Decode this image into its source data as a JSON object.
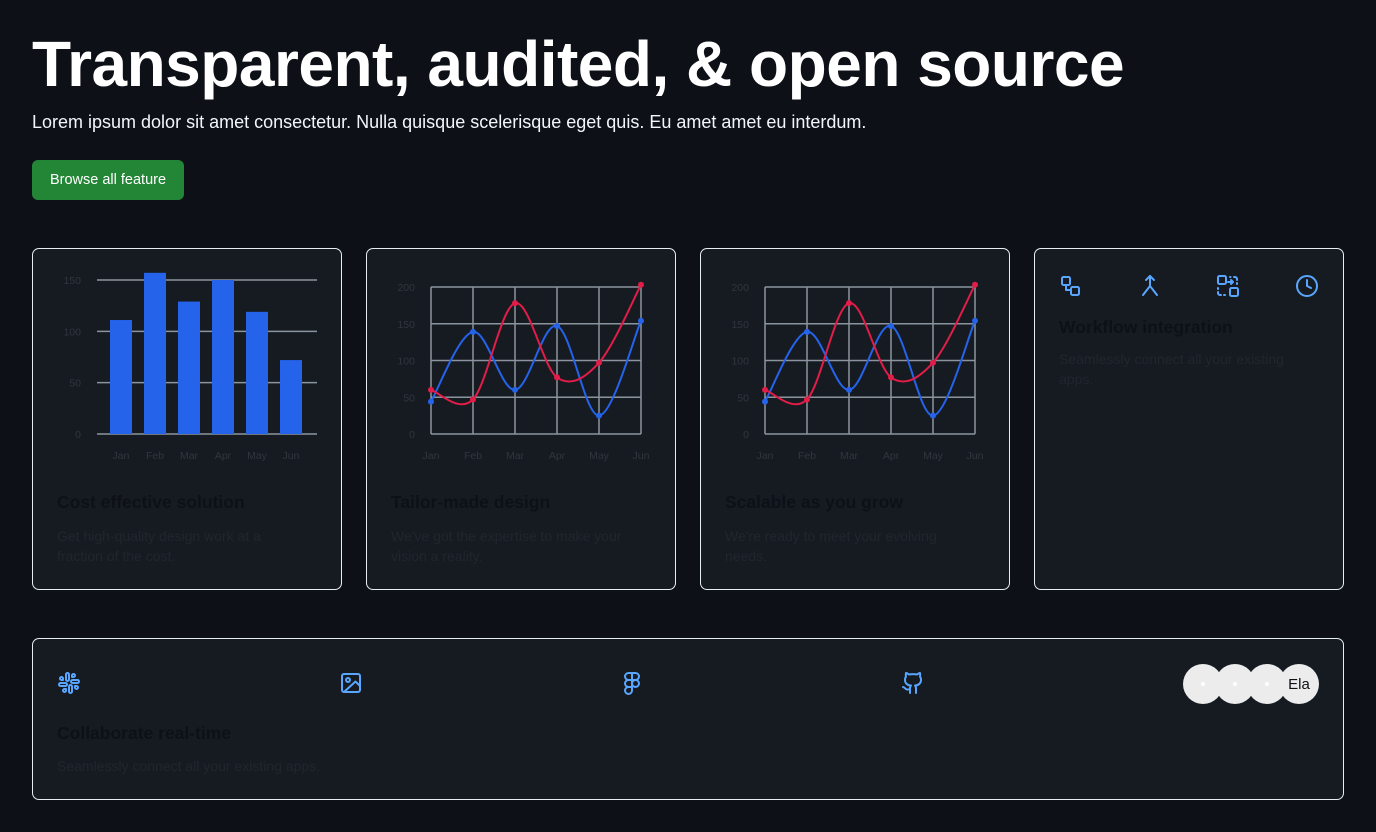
{
  "hero": {
    "title": "Transparent, audited, & open source",
    "subtitle": "Lorem ipsum dolor sit amet consectetur. Nulla quisque scelerisque eget quis. Eu amet amet eu interdum.",
    "cta_label": "Browse all feature"
  },
  "cards": [
    {
      "title": "Cost effective solution",
      "description": "Get high-quality design work at a fraction of the cost."
    },
    {
      "title": "Tailor-made design",
      "description": "We've got the expertise to make your vision a reality."
    },
    {
      "title": "Scalable as you grow",
      "description": "We're ready to meet your evolving needs."
    },
    {
      "title": "Workflow integration",
      "description": "Seamlessly connect all your existing apps."
    }
  ],
  "workflow_icons": [
    "workflow-icon",
    "merge-icon",
    "integration-icon",
    "clock-icon"
  ],
  "collaborate": {
    "title": "Collaborate real-time",
    "description": "Seamlessly connect all your existing apps.",
    "icons": [
      "slack-icon",
      "image-icon",
      "figma-icon",
      "github-icon"
    ],
    "avatars": [
      "",
      "",
      "",
      "Ela"
    ]
  },
  "colors": {
    "background": "#0d1117",
    "card": "#161b22",
    "accent_green": "#238636",
    "chart_blue": "#2563eb",
    "chart_red": "#e11d48",
    "icon_blue": "#58a6ff"
  },
  "chart_data": [
    {
      "type": "bar",
      "categories": [
        "Jan",
        "Feb",
        "Mar",
        "Apr",
        "May",
        "Jun"
      ],
      "values": [
        111,
        157,
        129,
        150,
        119,
        72
      ],
      "ylim": [
        0,
        150
      ],
      "yticks": [
        0,
        50,
        100,
        150
      ],
      "grid": true,
      "color": "#2563eb"
    },
    {
      "type": "line",
      "categories": [
        "Jan",
        "Feb",
        "Mar",
        "Apr",
        "May",
        "Jun"
      ],
      "ylim": [
        0,
        200
      ],
      "yticks": [
        0,
        50,
        100,
        150,
        200
      ],
      "grid": true,
      "series": [
        {
          "color": "#2563eb",
          "values": [
            44,
            139,
            60,
            147,
            25,
            154
          ]
        },
        {
          "color": "#e11d48",
          "values": [
            60,
            47,
            178,
            77,
            97,
            203
          ]
        }
      ]
    },
    {
      "type": "line",
      "categories": [
        "Jan",
        "Feb",
        "Mar",
        "Apr",
        "May",
        "Jun"
      ],
      "ylim": [
        0,
        200
      ],
      "yticks": [
        0,
        50,
        100,
        150,
        200
      ],
      "grid": true,
      "series": [
        {
          "color": "#2563eb",
          "values": [
            44,
            139,
            60,
            147,
            25,
            154
          ]
        },
        {
          "color": "#e11d48",
          "values": [
            60,
            47,
            178,
            77,
            97,
            203
          ]
        }
      ]
    }
  ]
}
